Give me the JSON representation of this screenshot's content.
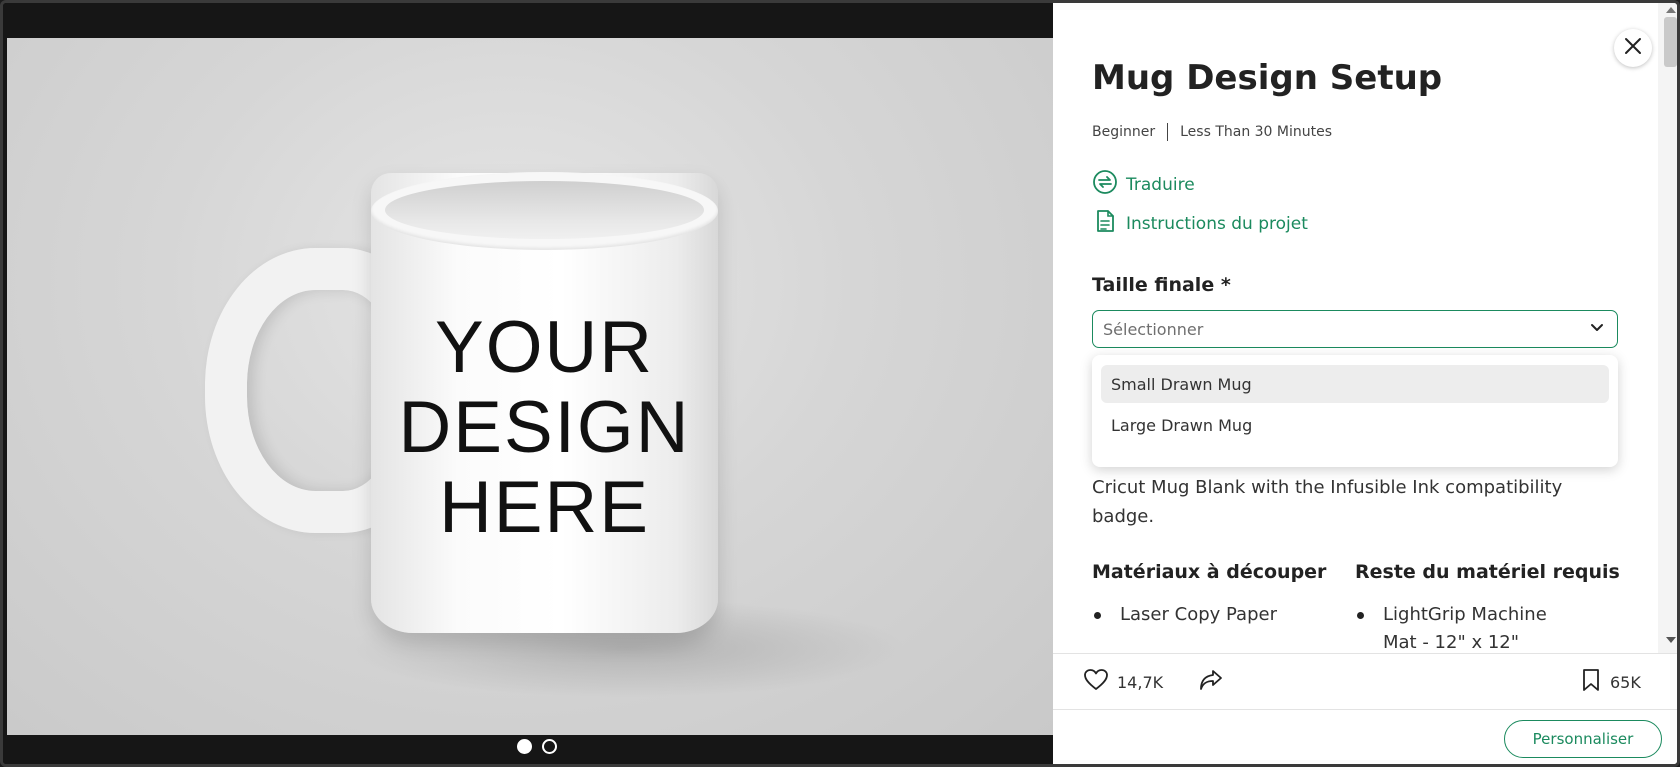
{
  "project": {
    "title": "Mug Design Setup",
    "level": "Beginner",
    "duration": "Less Than 30 Minutes"
  },
  "links": {
    "translate": "Traduire",
    "instructions": "Instructions du projet"
  },
  "size_field": {
    "label": "Taille finale *",
    "placeholder": "Sélectionner",
    "options": [
      "Small Drawn Mug",
      "Large Drawn Mug"
    ]
  },
  "description": {
    "lines": [
      "Cricut Mug Blank with the Infusible Ink compatibility",
      "badge."
    ]
  },
  "materials": {
    "cut_heading": "Matériaux à découper",
    "cut_items": [
      "Laser Copy Paper"
    ],
    "other_heading": "Reste du matériel requis",
    "other_items": [
      "LightGrip Machine Mat - 12\" x 12\""
    ]
  },
  "mug_image": {
    "lines": [
      "YOUR",
      "DESIGN",
      "HERE"
    ]
  },
  "carousel": {
    "count": 2,
    "active_index": 0
  },
  "actions": {
    "likes": "14,7K",
    "saves": "65K"
  },
  "footer": {
    "customize_label": "Personnaliser"
  },
  "colors": {
    "accent": "#1b8a5e"
  }
}
